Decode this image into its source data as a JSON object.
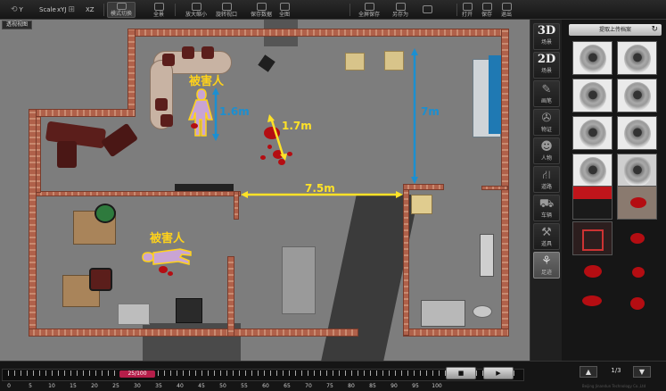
{
  "toolbar": {
    "axis_y": "Y",
    "axis_scale": "Scale",
    "axis_xyj": "xYJ",
    "axis_xz": "XZ",
    "buttons": [
      "模式切换",
      "全景",
      "放大缩小",
      "旋转视口",
      "保存数据",
      "全图",
      "全屏保存",
      "另存为",
      "打开",
      "保存",
      "退出"
    ]
  },
  "scene": {
    "view_tab": "透视视图",
    "victim_label_1": "被害人",
    "victim_label_2": "被害人",
    "measure_vertical_small": "1.6m",
    "measure_diagonal": "1.7m",
    "measure_room_height": "7m",
    "measure_horizontal": "7.5m",
    "colors": {
      "measure_blue": "#1b8fd1",
      "measure_yellow": "#ffe227",
      "label_yellow": "#ffd21a",
      "blood": "#b40d12"
    }
  },
  "tools": [
    {
      "big": "3D",
      "label": "场景",
      "icon": "3d-view-icon"
    },
    {
      "big": "2D",
      "label": "场景",
      "icon": "2d-view-icon"
    },
    {
      "big": "",
      "label": "画笔",
      "icon": "pen-icon"
    },
    {
      "big": "",
      "label": "物证",
      "icon": "film-reel-icon"
    },
    {
      "big": "",
      "label": "人物",
      "icon": "people-icon"
    },
    {
      "big": "",
      "label": "道路",
      "icon": "road-icon"
    },
    {
      "big": "",
      "label": "车辆",
      "icon": "car-icon"
    },
    {
      "big": "",
      "label": "道具",
      "icon": "tools-icon"
    },
    {
      "big": "",
      "label": "足迹",
      "icon": "footprint-icon"
    }
  ],
  "library": {
    "header": "提取上传档案",
    "refresh_icon": "refresh-icon",
    "page": "1/3"
  },
  "timeline": {
    "time_badge": "25/100",
    "ticks": [
      "0",
      "5",
      "10",
      "15",
      "20",
      "25",
      "30",
      "35",
      "40",
      "45",
      "50",
      "55",
      "60",
      "65",
      "70",
      "75",
      "80",
      "85",
      "90",
      "95",
      "100"
    ],
    "stop_label": "■",
    "play_label": "▶"
  },
  "footer": {
    "copyright": "Beijing Jinandun Technology Co.,Ltd"
  }
}
